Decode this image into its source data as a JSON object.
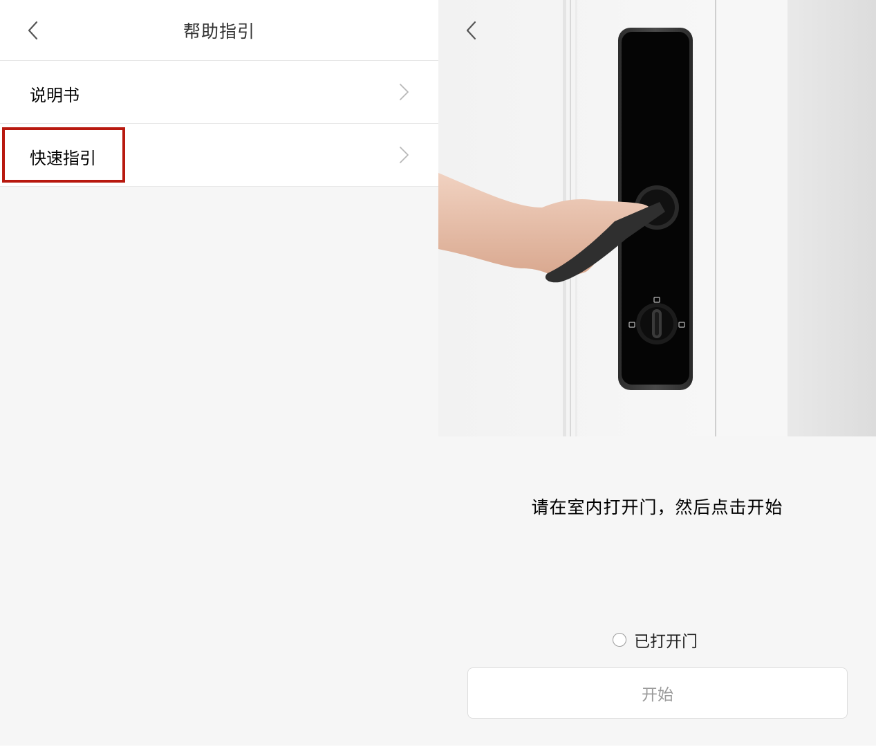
{
  "left_screen": {
    "title": "帮助指引",
    "items": [
      {
        "label": "说明书"
      },
      {
        "label": "快速指引",
        "highlighted": true
      }
    ],
    "highlight_color": "#b8190f"
  },
  "right_screen": {
    "instruction": "请在室内打开门，然后点击开始",
    "door_opened_checkbox": {
      "label": "已打开门",
      "checked": false
    },
    "start_button": {
      "label": "开始",
      "enabled": false
    }
  },
  "colors": {
    "background": "#f6f6f6",
    "surface": "#ffffff",
    "text_primary": "#000000",
    "text_disabled": "#9a9a9a"
  }
}
